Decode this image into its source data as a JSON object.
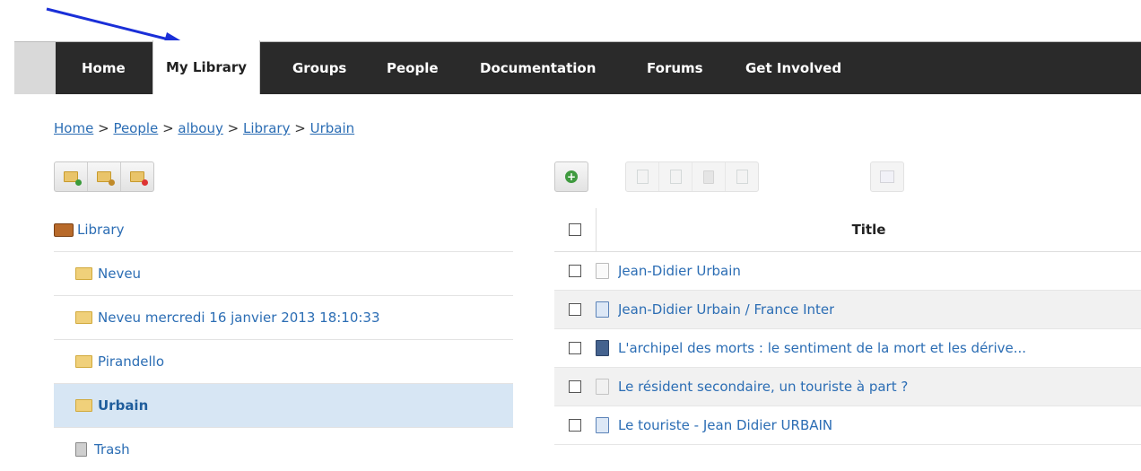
{
  "nav": {
    "items": [
      {
        "label": "Home"
      },
      {
        "label": "My Library"
      },
      {
        "label": "Groups"
      },
      {
        "label": "People"
      },
      {
        "label": "Documentation"
      },
      {
        "label": "Forums"
      },
      {
        "label": "Get Involved"
      }
    ],
    "active": "My Library"
  },
  "breadcrumb": {
    "items": [
      "Home",
      "People",
      "albouy",
      "Library",
      "Urbain"
    ],
    "separator": ">"
  },
  "library_toolbar": {
    "buttons": [
      "new-collection-icon",
      "edit-collection-icon",
      "delete-collection-icon"
    ]
  },
  "items_toolbar": {
    "buttons": [
      "add-item-icon",
      "new-child-note-icon",
      "new-attachment-icon",
      "trash-icon",
      "move-icon",
      "export-icon"
    ]
  },
  "tree": {
    "root": "Library",
    "collections": [
      {
        "label": "Neveu"
      },
      {
        "label": "Neveu mercredi 16 janvier 2013 18:10:33"
      },
      {
        "label": "Pirandello"
      },
      {
        "label": "Urbain"
      }
    ],
    "selected": "Urbain",
    "trash": "Trash"
  },
  "items_table": {
    "header": "Title",
    "rows": [
      {
        "title": "Jean-Didier Urbain",
        "type": "document"
      },
      {
        "title": "Jean-Didier Urbain / France Inter",
        "type": "webpage"
      },
      {
        "title": "L'archipel des morts : le sentiment de la mort et les dérive...",
        "type": "book"
      },
      {
        "title": "Le résident secondaire, un touriste à part ?",
        "type": "note"
      },
      {
        "title": "Le touriste - Jean Didier URBAIN",
        "type": "webpage"
      }
    ]
  },
  "colors": {
    "nav_bg": "#2a2a2a",
    "link": "#2b6db4",
    "selected_row": "#d7e6f4",
    "arrow": "#1a2fd8"
  }
}
